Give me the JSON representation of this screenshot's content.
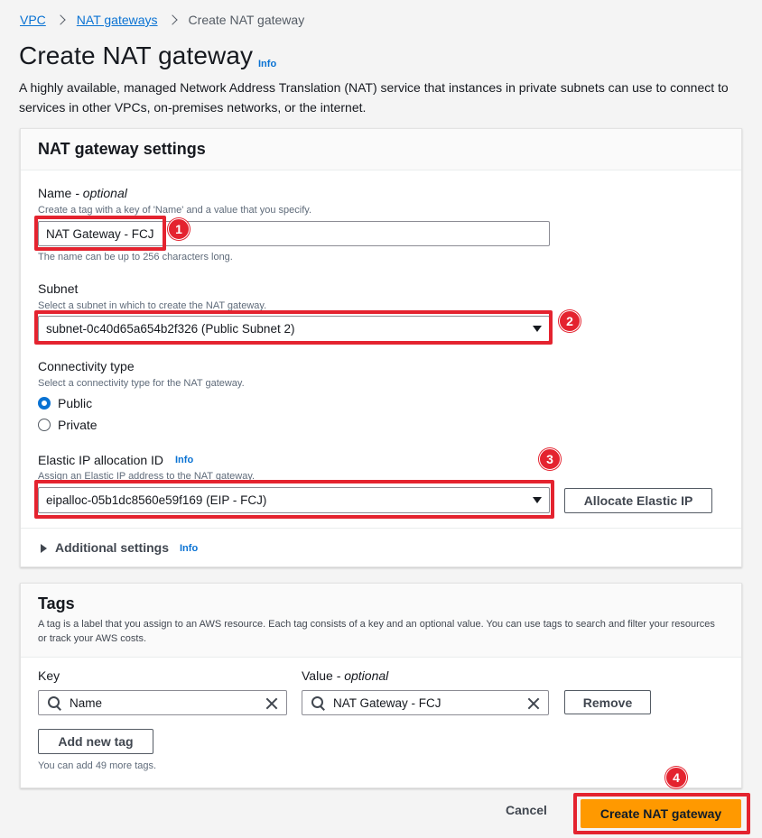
{
  "breadcrumb": {
    "items": [
      "VPC",
      "NAT gateways"
    ],
    "current": "Create NAT gateway"
  },
  "page": {
    "title": "Create NAT gateway",
    "info": "Info",
    "description": "A highly available, managed Network Address Translation (NAT) service that instances in private subnets can use to connect to services in other VPCs, on-premises networks, or the internet."
  },
  "settings": {
    "title": "NAT gateway settings",
    "name": {
      "label": "Name",
      "optional": " - optional",
      "hint": "Create a tag with a key of 'Name' and a value that you specify.",
      "value": "NAT Gateway - FCJ",
      "constraint": "The name can be up to 256 characters long."
    },
    "subnet": {
      "label": "Subnet",
      "hint": "Select a subnet in which to create the NAT gateway.",
      "value": "subnet-0c40d65a654b2f326 (Public Subnet 2)"
    },
    "connectivity": {
      "label": "Connectivity type",
      "hint": "Select a connectivity type for the NAT gateway.",
      "options": [
        "Public",
        "Private"
      ],
      "selected": "Public"
    },
    "elastic_ip": {
      "label": "Elastic IP allocation ID",
      "info": "Info",
      "hint": "Assign an Elastic IP address to the NAT gateway.",
      "value": "eipalloc-05b1dc8560e59f169 (EIP - FCJ)",
      "allocate_label": "Allocate Elastic IP"
    },
    "additional": {
      "label": "Additional settings",
      "info": "Info"
    }
  },
  "tags": {
    "title": "Tags",
    "description": "A tag is a label that you assign to an AWS resource. Each tag consists of a key and an optional value. You can use tags to search and filter your resources or track your AWS costs.",
    "key_label": "Key",
    "value_label": "Value",
    "value_optional": " - optional",
    "key_value": "Name",
    "value_value": "NAT Gateway - FCJ",
    "remove_label": "Remove",
    "add_label": "Add new tag",
    "remaining": "You can add 49 more tags."
  },
  "footer": {
    "cancel_label": "Cancel",
    "create_label": "Create NAT gateway"
  },
  "annotations": {
    "steps": [
      "1",
      "2",
      "3",
      "4"
    ],
    "color": "#e4232f"
  },
  "colors": {
    "link": "#0972d3",
    "primary": "#ff9900"
  }
}
